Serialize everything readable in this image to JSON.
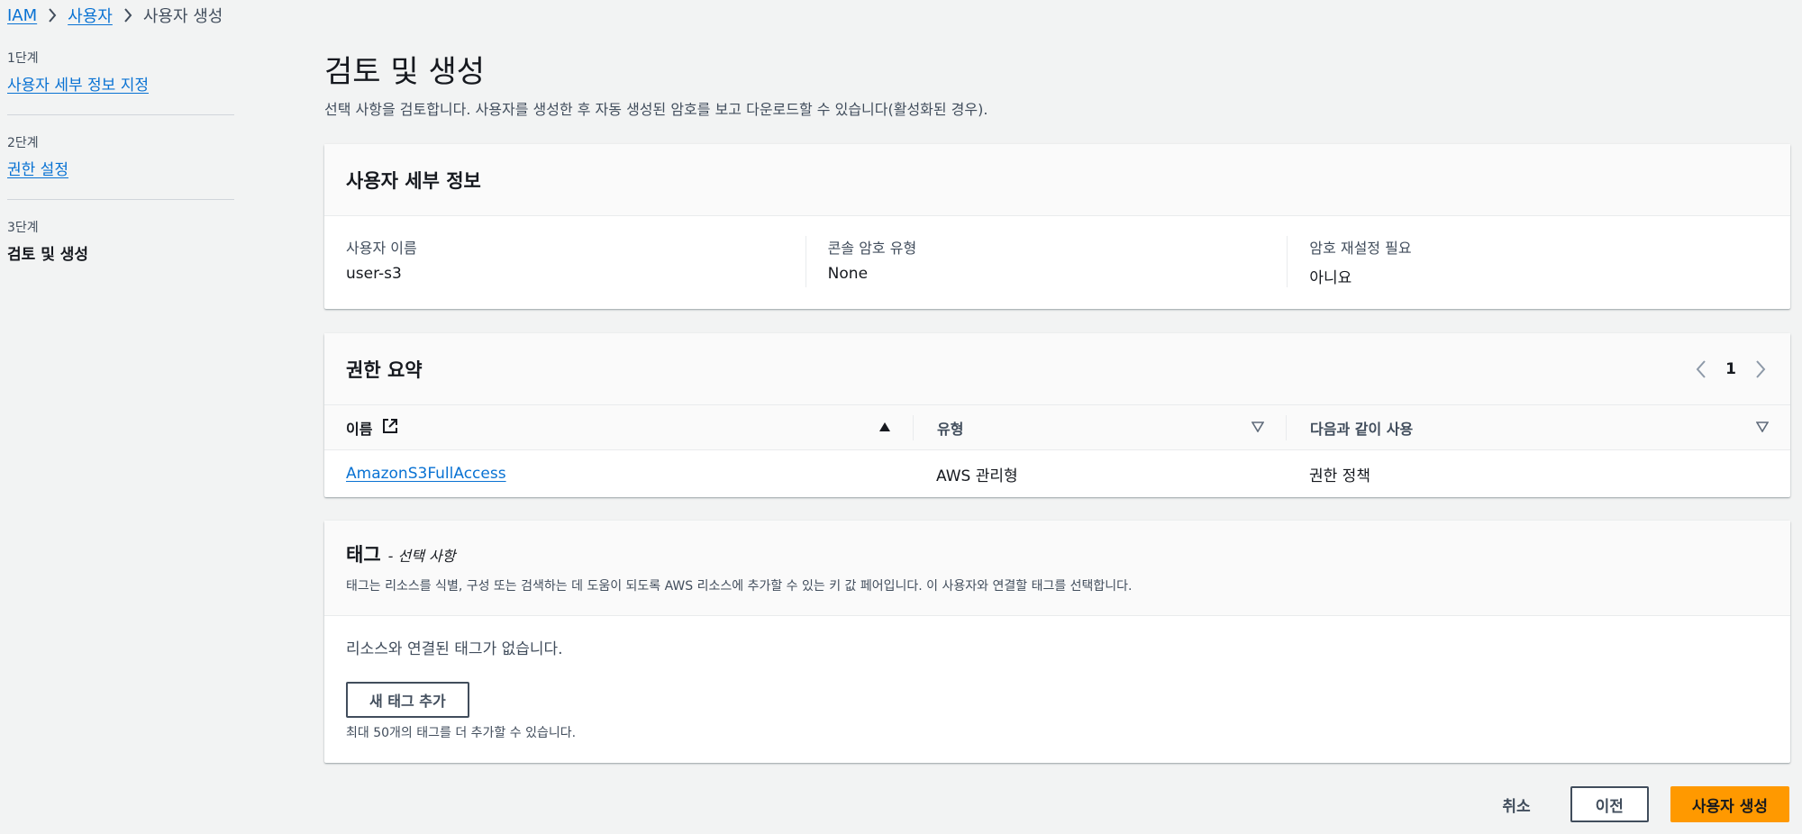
{
  "breadcrumb": {
    "items": [
      "IAM",
      "사용자"
    ],
    "current": "사용자 생성"
  },
  "steps": [
    {
      "num": "1단계",
      "title": "사용자 세부 정보 지정"
    },
    {
      "num": "2단계",
      "title": "권한 설정"
    },
    {
      "num": "3단계",
      "title": "검토 및 생성"
    }
  ],
  "page": {
    "title": "검토 및 생성",
    "description": "선택 사항을 검토합니다. 사용자를 생성한 후 자동 생성된 암호를 보고 다운로드할 수 있습니다(활성화된 경우)."
  },
  "user_details": {
    "title": "사용자 세부 정보",
    "fields": [
      {
        "label": "사용자 이름",
        "value": "user-s3"
      },
      {
        "label": "콘솔 암호 유형",
        "value": "None"
      },
      {
        "label": "암호 재설정 필요",
        "value": "아니요"
      }
    ]
  },
  "permissions": {
    "title": "권한 요약",
    "page": "1",
    "columns": [
      "이름",
      "유형",
      "다음과 같이 사용"
    ],
    "rows": [
      {
        "name": "AmazonS3FullAccess",
        "type": "AWS 관리형",
        "used_as": "권한 정책"
      }
    ]
  },
  "tags": {
    "title": "태그",
    "optional": "- 선택 사항",
    "description": "태그는 리소스를 식별, 구성 또는 검색하는 데 도움이 되도록 AWS 리소스에 추가할 수 있는 키 값 페어입니다. 이 사용자와 연결할 태그를 선택합니다.",
    "empty": "리소스와 연결된 태그가 없습니다.",
    "add_button": "새 태그 추가",
    "hint": "최대 50개의 태그를 더 추가할 수 있습니다."
  },
  "footer": {
    "cancel": "취소",
    "previous": "이전",
    "create": "사용자 생성"
  },
  "colors": {
    "link": "#0972d3",
    "primary": "#ff9900",
    "background": "#f2f3f3"
  }
}
